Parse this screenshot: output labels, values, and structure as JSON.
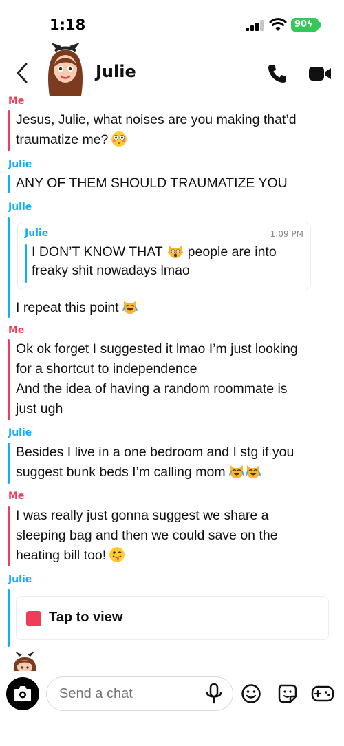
{
  "status_bar": {
    "time": "1:18",
    "battery": "90"
  },
  "header": {
    "contact_name": "Julie"
  },
  "messages": [
    {
      "sender": "Me",
      "text": "Jesus, Julie, what noises are you making that’d\ntraumatize me?",
      "emoji": "flushed-face-emoji"
    },
    {
      "sender": "Julie",
      "text": "ANY OF THEM SHOULD TRAUMATIZE YOU"
    },
    {
      "sender": "Julie",
      "quote": {
        "sender": "Julie",
        "time": "1:09 PM",
        "text_a": "I DON’T KNOW THAT",
        "emoji": "scream-cat-emoji",
        "text_b": "people are into\nfreaky shit nowadays lmao"
      },
      "text": "I repeat this point",
      "emoji": "joy-cat-emoji"
    },
    {
      "sender": "Me",
      "text": "Ok ok forget I suggested it lmao I’m just looking\nfor a shortcut to independence\nAnd the idea of having a random roommate is\njust ugh"
    },
    {
      "sender": "Julie",
      "text": "Besides I live in a one bedroom and I stg if you\nsuggest bunk beds I’m calling mom",
      "emoji": "joy-cat-emoji"
    },
    {
      "sender": "Me",
      "text": "I was really just gonna suggest we share a\nsleeping bag and then we could save on the\nheating bill too!",
      "emoji": "winking-tongue-emoji"
    },
    {
      "sender": "Julie",
      "snap_label": "Tap to view"
    }
  ],
  "input": {
    "placeholder": "Send a chat"
  },
  "colors": {
    "me": "#f23c57",
    "julie": "#0eadff",
    "snap": "#f23c57"
  }
}
